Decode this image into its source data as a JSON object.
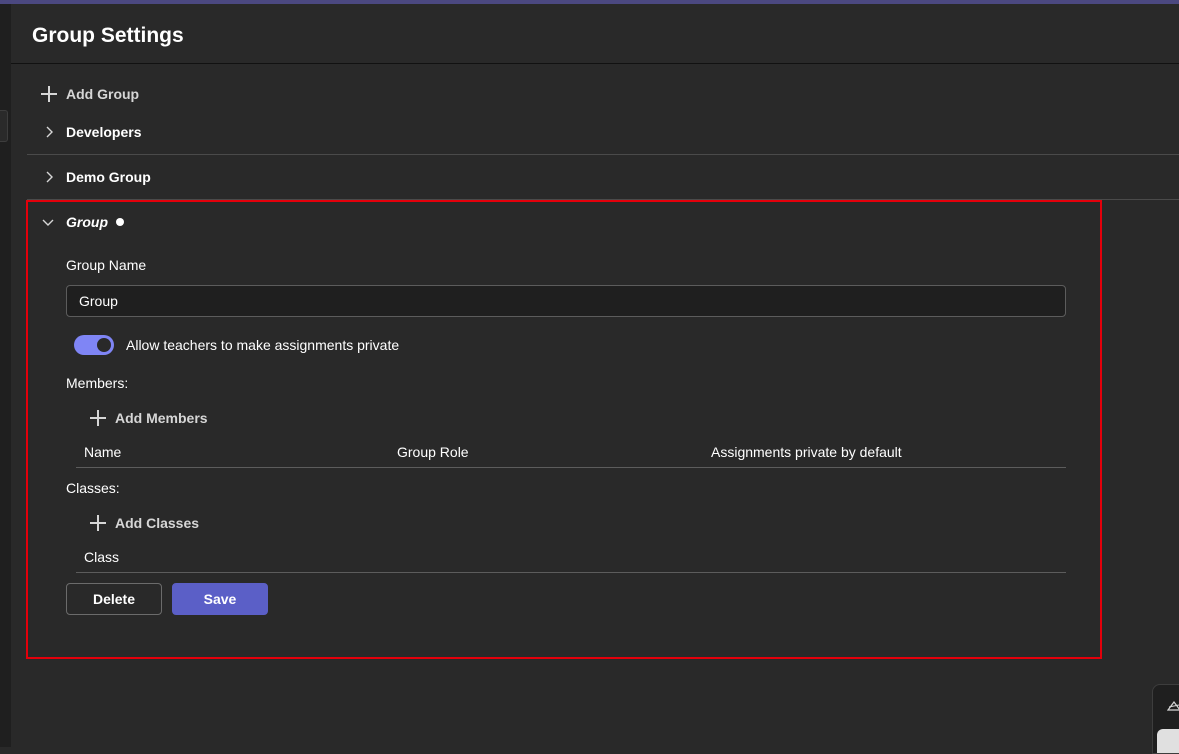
{
  "header": {
    "title": "Group Settings"
  },
  "groups": {
    "add_label": "Add Group",
    "items": [
      {
        "label": "Developers",
        "expanded": false
      },
      {
        "label": "Demo Group",
        "expanded": false
      },
      {
        "label": "Group",
        "expanded": true,
        "unsaved": true
      }
    ]
  },
  "form": {
    "group_name_label": "Group Name",
    "group_name_value": "Group",
    "toggle_label": "Allow teachers to make assignments private",
    "toggle_on": true,
    "members": {
      "label": "Members:",
      "add_label": "Add Members",
      "columns": [
        "Name",
        "Group Role",
        "Assignments private by default"
      ]
    },
    "classes": {
      "label": "Classes:",
      "add_label": "Add Classes",
      "columns": [
        "Class"
      ]
    },
    "delete_label": "Delete",
    "save_label": "Save"
  },
  "colors": {
    "accent": "#5b5fc7",
    "toggle_on": "#7f85f5",
    "highlight_border": "#e3000b",
    "background": "#292929"
  }
}
